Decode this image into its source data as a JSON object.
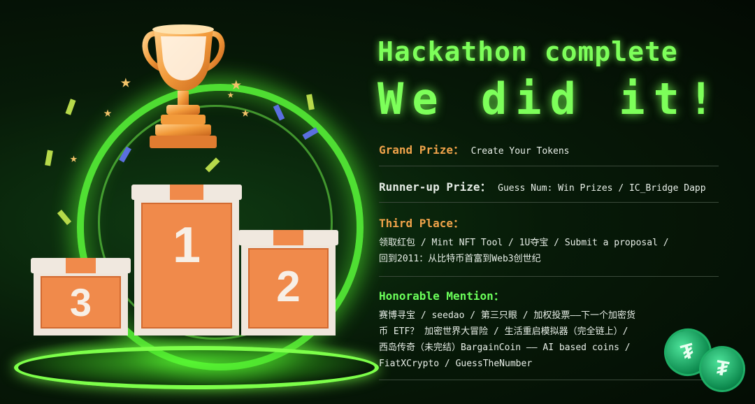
{
  "hero": {
    "title_line1": "Hackathon complete",
    "title_line2": "We did it!"
  },
  "podium": {
    "first": "1",
    "second": "2",
    "third": "3"
  },
  "prizes": {
    "grand": {
      "label": "Grand Prize：",
      "value": "Create Your Tokens"
    },
    "runner_up": {
      "label": "Runner-up Prize：",
      "value": "Guess Num: Win Prizes / IC_Bridge Dapp"
    },
    "third": {
      "label": "Third Place：",
      "lines": [
        "领取红包 / Mint NFT Tool / 1U夺宝 / Submit a proposal /",
        "回到2011：从比特币首富到Web3创世纪"
      ]
    },
    "honorable": {
      "label": "Honorable Mention：",
      "lines": [
        "赛博寻宝 / seedao / 第三只眼 / 加权投票——下一个加密货",
        "币 ETF？ 加密世界大冒险 / 生活重启模拟器（完全链上）/",
        "西岛传奇（未完结）BargainCoin —— AI based coins /",
        "FiatXCrypto / GuessTheNumber"
      ]
    }
  },
  "colors": {
    "accent_green": "#7dff5a",
    "grand_label": "#f0a34a",
    "third_label": "#f0a34a",
    "honorable_label": "#6bff5a",
    "podium_orange": "#f08a4b"
  },
  "icons": [
    "trophy-icon",
    "tether-coin-icon",
    "star-icon"
  ]
}
